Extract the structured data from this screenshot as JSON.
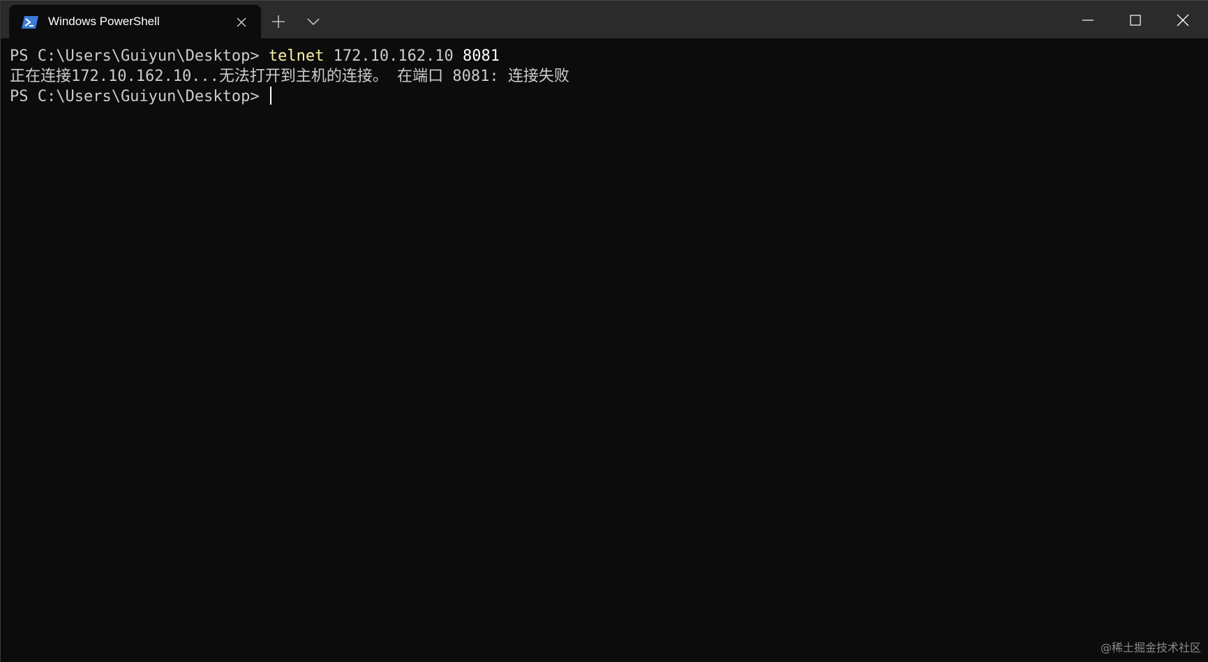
{
  "window": {
    "tab_title": "Windows PowerShell",
    "tab_icon": "powershell-icon",
    "new_tab_icon": "plus-icon",
    "dropdown_icon": "chevron-down-icon",
    "minimize_icon": "minimize-icon",
    "maximize_icon": "maximize-icon",
    "close_icon": "close-icon"
  },
  "terminal": {
    "line1": {
      "prompt": "PS C:\\Users\\Guiyun\\Desktop> ",
      "command": "telnet",
      "arg": " 172.10.162.10 ",
      "port": "8081"
    },
    "line2": "正在连接172.10.162.10...无法打开到主机的连接。 在端口 8081: 连接失败",
    "line3": {
      "prompt": "PS C:\\Users\\Guiyun\\Desktop> "
    }
  },
  "watermark": "@稀土掘金技术社区",
  "colors": {
    "background": "#0c0c0c",
    "titlebar": "#2b2b2b",
    "text": "#cccccc",
    "command": "#f9f1a5",
    "icon_blue": "#3b7bd9"
  }
}
